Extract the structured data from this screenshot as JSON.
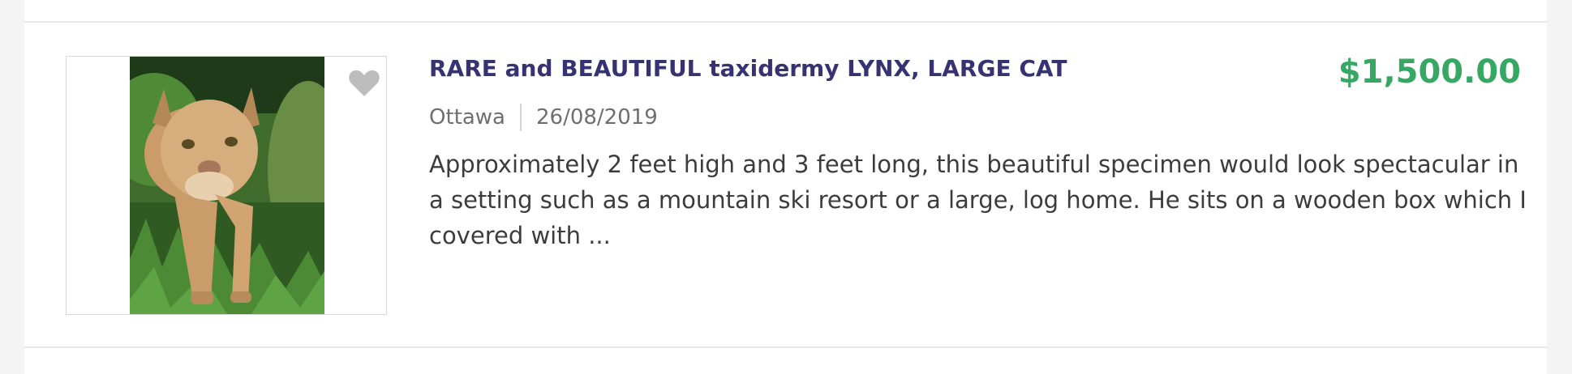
{
  "listing": {
    "title": "RARE and BEAUTIFUL taxidermy LYNX, LARGE CAT",
    "price": "$1,500.00",
    "location": "Ottawa",
    "date": "26/08/2019",
    "description": "Approximately 2 feet high and 3 feet long, this beautiful specimen would look spectacular in a setting such as a mountain ski resort or a large, log home. He sits on a wooden box which I covered with ...",
    "image_subject": "lynx-photo",
    "favorite_icon": "heart-icon"
  },
  "colors": {
    "title": "#373373",
    "price": "#37a864",
    "meta": "#6f6f6f",
    "description": "#3c3c3c",
    "divider": "#e8e8e8"
  }
}
